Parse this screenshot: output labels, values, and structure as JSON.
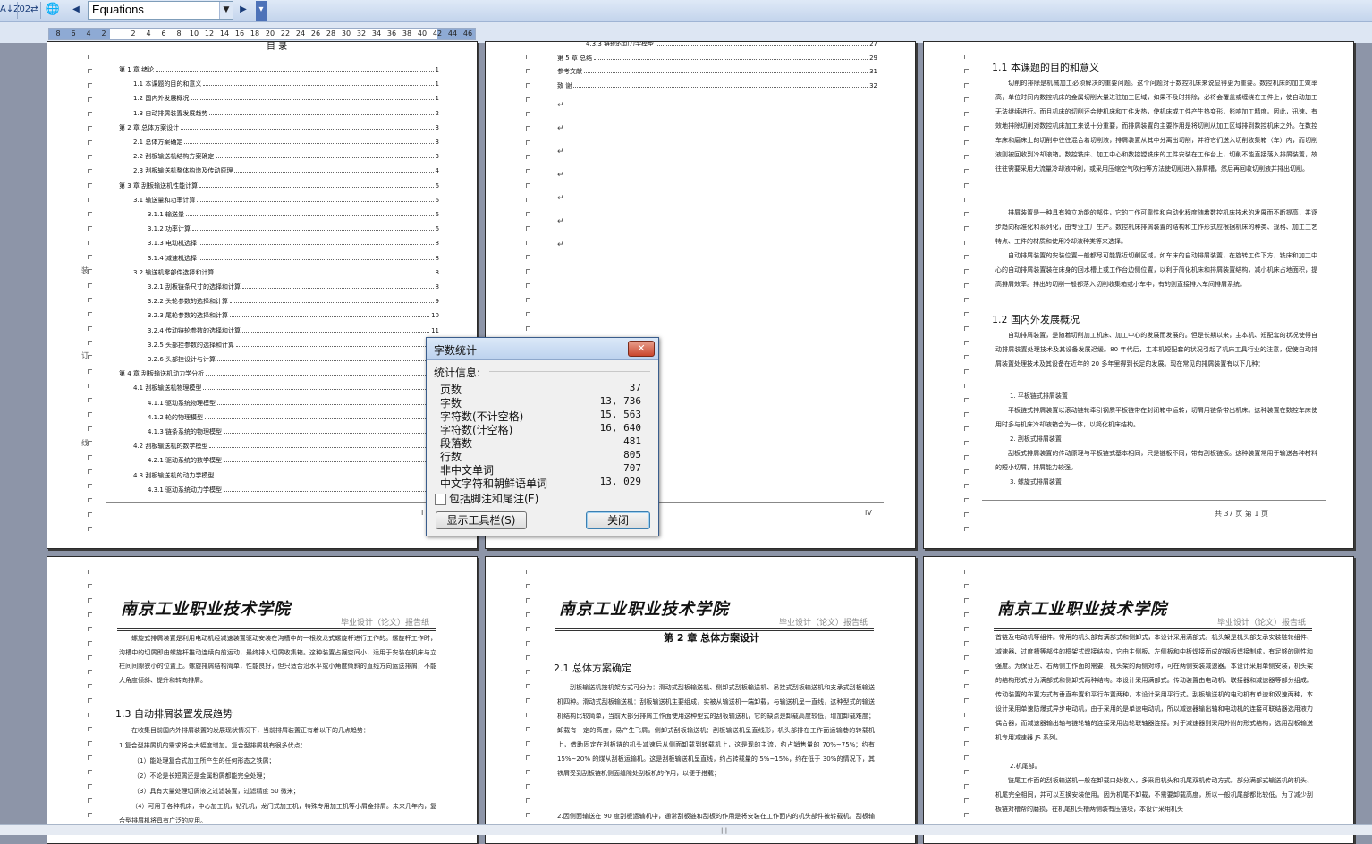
{
  "toolbar": {
    "combo_value": "Equations",
    "btn_sort": "A↓Z",
    "btn_ruler": "02⇄",
    "btn_lang": "🌐",
    "btn_back": "◀",
    "btn_forward": "▶",
    "btn_menu": "▾"
  },
  "ruler": {
    "left_numbers": [
      "8",
      "6",
      "4",
      "2"
    ],
    "right_numbers": [
      "2",
      "4",
      "6",
      "8",
      "10",
      "12",
      "14",
      "16",
      "18",
      "20",
      "22",
      "24",
      "26",
      "28",
      "30",
      "32",
      "34",
      "36",
      "38",
      "40",
      "42",
      "44",
      "46"
    ]
  },
  "page1": {
    "title": "目 录",
    "side_labels": [
      "装",
      "订",
      "线"
    ],
    "toc": [
      {
        "text": "第 1 章  绪论",
        "page": "1"
      },
      {
        "text": "1.1  本课题的目的和意义",
        "page": "1"
      },
      {
        "text": "1.2  国内外发展概况",
        "page": "1"
      },
      {
        "text": "1.3  自动排屑装置发展趋势",
        "page": "2"
      },
      {
        "text": "第 2 章  总体方案设计",
        "page": "3"
      },
      {
        "text": "2.1  总体方案确定",
        "page": "3"
      },
      {
        "text": "2.2  刮板输送机结构方案确定",
        "page": "3"
      },
      {
        "text": "2.3  刮板输送机整体构造及传动原理",
        "page": "4"
      },
      {
        "text": "第 3 章  刮板输送机性能计算",
        "page": "6"
      },
      {
        "text": "3.1  输送量和功率计算",
        "page": "6"
      },
      {
        "text": "3.1.1  输送量",
        "page": "6"
      },
      {
        "text": "3.1.2  功率计算",
        "page": "6"
      },
      {
        "text": "3.1.3  电动机选择",
        "page": "8"
      },
      {
        "text": "3.1.4  减速机选择",
        "page": "8"
      },
      {
        "text": "3.2  输送机零部件选择和计算",
        "page": "8"
      },
      {
        "text": "3.2.1  刮板链条尺寸的选择和计算",
        "page": "8"
      },
      {
        "text": "3.2.2  头轮参数的选择和计算",
        "page": "9"
      },
      {
        "text": "3.2.3  尾轮参数的选择和计算",
        "page": "10"
      },
      {
        "text": "3.2.4  传动链轮参数的选择和计算",
        "page": "11"
      },
      {
        "text": "3.2.5  头部挂参数的选择和计算",
        "page": "12"
      },
      {
        "text": "3.2.6  头部挂设计与计算",
        "page": "12"
      },
      {
        "text": "第 4 章  刮板输送机动力学分析",
        "page": "13"
      },
      {
        "text": "4.1  刮板输送机物理模型",
        "page": "13"
      },
      {
        "text": "4.1.1  驱动系统物理模型",
        "page": "13"
      },
      {
        "text": "4.1.2  轮的物理模型",
        "page": "14"
      },
      {
        "text": "4.1.3  链条系统的物理模型",
        "page": "15"
      },
      {
        "text": "4.2  刮板输送机的数学模型",
        "page": "16"
      },
      {
        "text": "4.2.1  驱动系统的数学模型",
        "page": "16"
      },
      {
        "text": "4.3  刮板输送机的动力学模型",
        "page": "17"
      },
      {
        "text": "4.3.1 驱动系统动力学模型",
        "page": "17"
      }
    ],
    "footer_page": "I"
  },
  "page2": {
    "toc": [
      {
        "text": "4.3.3  链轮的动力学模型",
        "page": "27"
      },
      {
        "text": "第 5 章  总结",
        "page": "29"
      },
      {
        "text": "参考文献",
        "page": "31"
      },
      {
        "text": "致    谢",
        "page": "32"
      }
    ],
    "footer_page": "IV"
  },
  "page3": {
    "h1": "1.1  本课题的目的和意义",
    "p1": "切削的排除是机械加工必须解决的重要问题。这个问题对于数控机床来说显得更为重要。数控机床的加工效率高，单位时间内数控机床的金属切削大量进驻加工区域，如果不及时排除，必将会覆盖或缠绕在工件上，使自动加工无法继续进行。而且机床的切削还会使机床和工件发热，使机床或工件产生热变形，影响加工精度。因此，迅速、有效地排除切削对数控机床加工来说十分重要，而排屑装置的主要作用是将切削从加工区域排到数控机床之外。在数控车床和磨床上的切削中往往混合着切削液，排屑装置从其中分离出切削，并将它们送入切削收集箱（车）内，而切削液则被回收到冷却液箱。数控铣床、加工中心和数控镗铣床的工件安装在工作台上，切削不能直接落入排屑装置，故往往需要采用大流量冷却液冲刷，或采用压缩空气吹扫等方法使切削进入排屑槽，然后再回收切削液并排出切削。",
    "p2": "排屑装置是一种具有独立功能的部件，它的工作可靠性和自动化程度随着数控机床技术的发展而不断提高，并逐步趋向标准化和系列化，由专业工厂生产。数控机床排屑装置的结构和工作形式应根据机床的种类、规格、加工工艺特点、工件的材质和使用冷却液种类等来选择。",
    "p3": "自动排屑装置的安装位置一般都尽可能靠近切削区域，如车床的自动排屑装置，在旋转工件下方，铣床和加工中心的自动排屑装置装在床身的回水槽上或工作台边侧位置，以利于简化机床和排屑装置结构，减小机床占地面积，提高排屑效率。排出的切削一般都落入切削收集箱或小车中，有的则直接排入车间排屑系统。",
    "h2": "1.2  国内外发展概况",
    "p4": "自动排屑装置，是随着切削加工机床、加工中心的发展而发展的。但是长期以来，主本机、短配套的状况使得自动排屑装置处理技术及其设备发展迟缓。80 年代后，主本机短配套的状况引起了机床工具行业的注意，促使自动排屑装置处理技术及其设备在近年的 20 多年里得到长足的发展。现在常见的排屑装置有以下几种：",
    "item1": "1.  平板链式排屑装置",
    "p5": "平板链式排屑装置以滚动链轮牵引钢质平板链带在封闭箱中运转，切屑用链条带出机床。这种装置在数控车床使用时多与机床冷却液箱合为一体，以简化机床结构。",
    "item2": "2.  刮板式排屑装置",
    "p6": "刮板式排屑装置的传动原理与平板链式基本相同，只是链板不同，带有刮板链板。这种装置常用于输送各种材料的短小切屑，排屑能力较强。",
    "item3": "3.  螺旋式排屑装置",
    "footer": "共  37  页    第  1  页"
  },
  "page4": {
    "school": "南京工业职业技术学院",
    "tag": "毕业设计（论文）报告纸",
    "p1": "螺旋式排屑装置是利用电动机经减速装置驱动安装在沟槽中的一根绞龙式螺旋杆进行工作的。螺旋杆工作时，沟槽中的切屑即由螺旋杆推动连续向前运动，最终排入切屑收集箱。这种装置占据空间小，适用于安装在机床与立柱间间隙狭小的位置上。螺旋排屑结构简单，性能良好，但只适合沿水平或小角度倾斜的直线方向运送排屑，不能大角度倾斜、提升和转向排屑。",
    "h": "1.3  自动排屑装置发展趋势",
    "p2": "在收集目前国内外排屑装置的发展现状情况下，当前排屑装置正有着以下的几点趋势：",
    "p3": "1.复合型排屑机的需求将会大幅度增加。复合型排屑机有很多优点：",
    "i1": "（1）能处理复合式加工所产生的任何形态之铁屑；",
    "i2": "（2）不论是长短屑还是金属粉屑都能完全处理；",
    "i3": "（3）具有大量处理切屑液之过滤装置，过滤精度 50 微米；",
    "i4": "（4）可用于各种机床，中心加工机，钻孔机，龙门式加工机，特殊专用加工机等小屑金排屑。未来几年内，复合型排屑机将具有广泛的应用。"
  },
  "page5": {
    "school": "南京工业职业技术学院",
    "tag": "毕业设计（论文）报告纸",
    "chapter": "第 2 章  总体方案设计",
    "h": "2.1  总体方案确定",
    "p1": "刮板输送机按机架方式可分为：滑动式刮板输送机、侧卸式刮板输送机、吊挂式刮板输送机和支承式刮板输送机四种。滑动式刮板输送机：刮板输送机主要组成，实被从输送机一端卸载，与输送机呈一直线，这种型式的输送机结构比较简单，当前大部分排屑工作面使用这种型式的刮板输送机，它的缺点是卸载高度较低，增加卸载难度；卸载有一定的高度，易产生飞屑。侧卸式刮板输送机：刮板输送机呈直线形，机头部排在工作面运输巷的转载机上，借助固定在刮板链的机头减速后从侧面卸载到转载机上，这是现的主流，约占销售量的 70%~75%；约有 15%~20% 的煤从刮板运输机。这是刮板输送机呈直线，约占转载量的 5%~15%，约在低于 30%的情况下，其铁屑受到刮板链机侧面缝隙处刮板机的作用，以便于搭载；",
    "p2": "2.因侧面输送在 90 度刮板运输机中，通常刮板链和刮板的作用是将安装在工作面内的机头部件被转载机。刮板输送机刮板高度较大，刮板运输机头部与刮板链是与刮板链在同一直线上。"
  },
  "page6": {
    "school": "南京工业职业技术学院",
    "tag": "毕业设计（论文）报告纸",
    "p1": "首链及电动机等组件。常用的机头部有满部式和侧卸式，本设计采用满部式。机头架是机头部支承安装链轮组件、减速器、过度槽等部件的框架式焊接结构，它由主侧板、左侧板和中板焊接而成的钢板焊接制成，有足够的刚性和强度。为保证左、右两侧工作面的需要，机头架的两侧对称，可在两侧安装减速器。本设计采用单侧安装，机头架的结构形式分为满部式和侧卸式两种结构。本设计采用满部式。传动装置由电动机、联接器和减速器等部分组成。传动装置的布置方式有垂直布置和平行布置两种，本设计采用平行式。刮板输送机的电动机有单速和双速两种，本设计采用单速防爆式异步电动机，由于采用的是单速电动机，所以减速器输出轴和电动机的连接可联结器选用液力偶合器，而减速器输出轴与链轮轴的连接采用齿轮联轴器连接。对于减速器则采用外附的形式结构，选用刮板输送机专用减速器 JS 系列。",
    "item": "2.机尾部。",
    "p2": "链尾工作面的刮板输送机一般在卸载口处收入，多采用机头和机尾双机传动方式。部分满部式输送机的机头、机尾完全相同，并可以互换安装使用。因为机尾不卸载，不需要卸载高度，所以一般机尾部都比较低。为了减少刮板链对槽帮的磨损，在机尾机头槽两侧装有压链块，本设计采用机头"
  },
  "dialog": {
    "title": "字数统计",
    "close_label": "✕",
    "section": "统计信息:",
    "stats": [
      {
        "name": "页数",
        "value": "37"
      },
      {
        "name": "字数",
        "value": "13, 736"
      },
      {
        "name": "字符数(不计空格)",
        "value": "15, 563"
      },
      {
        "name": "字符数(计空格)",
        "value": "16, 640"
      },
      {
        "name": "段落数",
        "value": "481"
      },
      {
        "name": "行数",
        "value": "805"
      },
      {
        "name": "非中文单词",
        "value": "707"
      },
      {
        "name": "中文字符和朝鲜语单词",
        "value": "13, 029"
      }
    ],
    "checkbox_label": "包括脚注和尾注(F)",
    "toolbar_button": "显示工具栏(S)",
    "close_button": "关闭"
  },
  "scrollbar": {
    "grip": "|||"
  }
}
